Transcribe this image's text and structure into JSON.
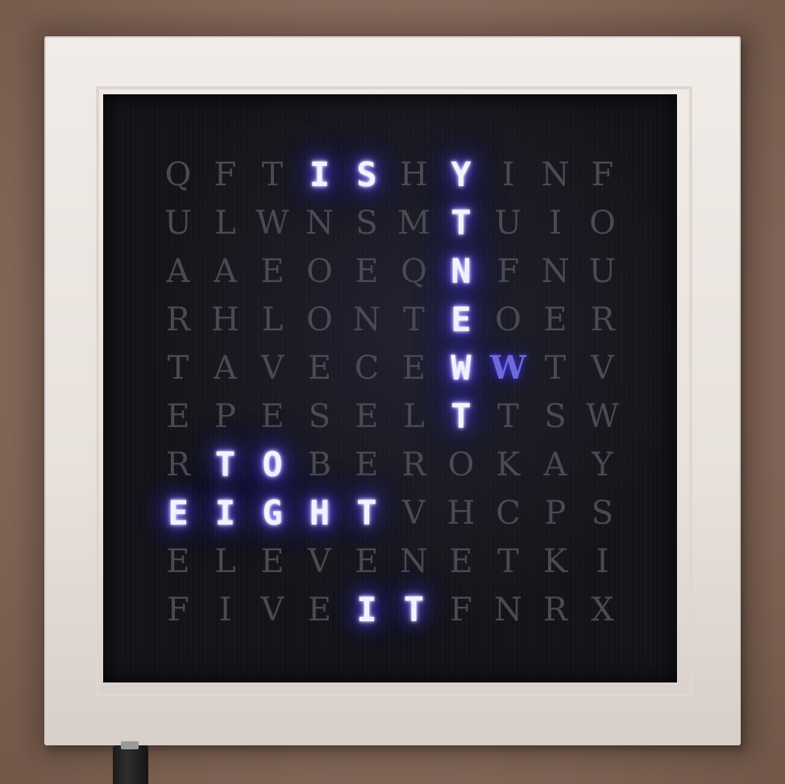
{
  "photo": {
    "subject": "word-clock",
    "accent_color": "#5a4dff",
    "unlit_color": "#4a4a52",
    "frame_color": "#ece6e1"
  },
  "clock": {
    "columns": 10,
    "rows": [
      {
        "letters": [
          "Q",
          "F",
          "T",
          "I",
          "S",
          "H",
          "Y",
          "I",
          "N",
          "F"
        ],
        "lit": [
          3,
          4,
          6
        ],
        "dim_lit": []
      },
      {
        "letters": [
          "U",
          "L",
          "W",
          "N",
          "S",
          "M",
          "T",
          "U",
          "I",
          "O"
        ],
        "lit": [
          6
        ],
        "dim_lit": []
      },
      {
        "letters": [
          "A",
          "A",
          "E",
          "O",
          "E",
          "Q",
          "N",
          "F",
          "N",
          "U"
        ],
        "lit": [
          6
        ],
        "dim_lit": []
      },
      {
        "letters": [
          "R",
          "H",
          "L",
          "O",
          "N",
          "T",
          "E",
          "O",
          "E",
          "R"
        ],
        "lit": [
          6
        ],
        "dim_lit": []
      },
      {
        "letters": [
          "T",
          "A",
          "V",
          "E",
          "C",
          "E",
          "W",
          "W",
          "T",
          "V"
        ],
        "lit": [
          6
        ],
        "dim_lit": [
          7
        ]
      },
      {
        "letters": [
          "E",
          "P",
          "E",
          "S",
          "E",
          "L",
          "T",
          "T",
          "S",
          "W"
        ],
        "lit": [
          6
        ],
        "dim_lit": []
      },
      {
        "letters": [
          "R",
          "T",
          "O",
          "B",
          "E",
          "R",
          "O",
          "K",
          "A",
          "Y"
        ],
        "lit": [
          1,
          2
        ],
        "dim_lit": []
      },
      {
        "letters": [
          "E",
          "I",
          "G",
          "H",
          "T",
          "V",
          "H",
          "C",
          "P",
          "S"
        ],
        "lit": [
          0,
          1,
          2,
          3,
          4
        ],
        "dim_lit": []
      },
      {
        "letters": [
          "E",
          "L",
          "E",
          "V",
          "E",
          "N",
          "E",
          "T",
          "K",
          "I"
        ],
        "lit": [],
        "dim_lit": []
      },
      {
        "letters": [
          "F",
          "I",
          "V",
          "E",
          "I",
          "T",
          "F",
          "N",
          "R",
          "X"
        ],
        "lit": [
          4,
          5
        ],
        "dim_lit": []
      }
    ]
  }
}
